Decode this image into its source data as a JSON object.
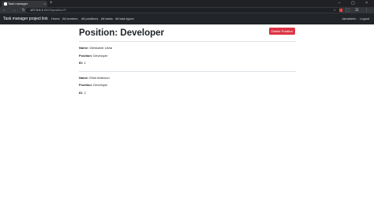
{
  "browser": {
    "tab_title": "Task manager",
    "tab_close": "×",
    "new_tab": "+",
    "window_controls": "–  ▢  ×",
    "nav_icons": "←  →  ↻  ⌂",
    "url_host": "127.0.0.1",
    "url_path": ":8000/position/7/"
  },
  "navbar": {
    "brand": "Task manager project link",
    "links": [
      "Home",
      "All workers",
      "All positions",
      "All tasks",
      "All task types"
    ],
    "user": "Jamadmin",
    "logout": "Logout"
  },
  "page": {
    "title": "Position: Developer",
    "delete_button": "Delete Position",
    "workers": [
      {
        "name_label": "Name:",
        "name": "Oleksandr Usha",
        "position_label": "Position:",
        "position": "Developer",
        "id_label": "ID:",
        "id": "1"
      },
      {
        "name_label": "Name:",
        "name": "Elliot Alderson",
        "position_label": "Position:",
        "position": "Developer",
        "id_label": "ID:",
        "id": "2"
      }
    ]
  },
  "colors": {
    "navbar": "#212529",
    "danger": "#dc3545",
    "browser": "#202124"
  }
}
